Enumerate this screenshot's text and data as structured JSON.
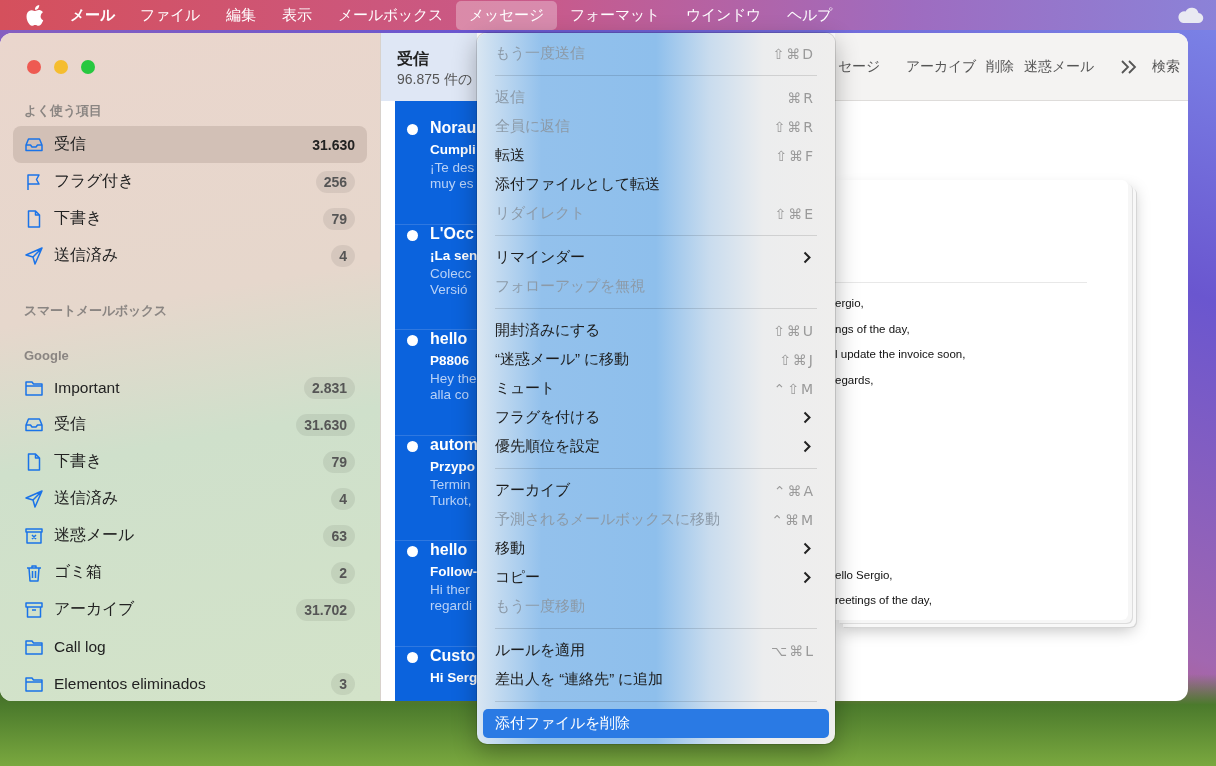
{
  "menu_bar": {
    "app_name": "メール",
    "items": [
      {
        "label": "ファイル",
        "selected": false
      },
      {
        "label": "編集",
        "selected": false
      },
      {
        "label": "表示",
        "selected": false
      },
      {
        "label": "メールボックス",
        "selected": false
      },
      {
        "label": "メッセージ",
        "selected": true
      },
      {
        "label": "フォーマット",
        "selected": false
      },
      {
        "label": "ウインドウ",
        "selected": false
      },
      {
        "label": "ヘルプ",
        "selected": false
      }
    ]
  },
  "sidebar": {
    "sections": [
      {
        "title": "よく使う項目",
        "items": [
          {
            "kind": "inbox",
            "label": "受信",
            "count": "31.630",
            "selected": true
          },
          {
            "kind": "flag",
            "label": "フラグ付き",
            "count": "256",
            "selected": false
          },
          {
            "kind": "draft",
            "label": "下書き",
            "count": "79",
            "selected": false
          },
          {
            "kind": "sent",
            "label": "送信済み",
            "count": "4",
            "selected": false
          }
        ]
      },
      {
        "title": "スマートメールボックス"
      },
      {
        "title": "Google",
        "items": [
          {
            "kind": "folder",
            "label": "Important",
            "count": "2.831",
            "selected": false
          },
          {
            "kind": "inbox",
            "label": "受信",
            "count": "31.630",
            "selected": false
          },
          {
            "kind": "draft",
            "label": "下書き",
            "count": "79",
            "selected": false
          },
          {
            "kind": "sent",
            "label": "送信済み",
            "count": "4",
            "selected": false
          },
          {
            "kind": "junk",
            "label": "迷惑メール",
            "count": "63",
            "selected": false
          },
          {
            "kind": "trash",
            "label": "ゴミ箱",
            "count": "2",
            "selected": false
          },
          {
            "kind": "archive",
            "label": "アーカイブ",
            "count": "31.702",
            "selected": false
          },
          {
            "kind": "folder",
            "label": "Call log",
            "selected": false
          },
          {
            "kind": "folder",
            "label": "Elementos eliminados",
            "count": "3",
            "selected": false
          }
        ]
      }
    ]
  },
  "message_list": {
    "title": "受信",
    "subtitle": "96.875 件の",
    "messages": [
      {
        "sender": "Norau",
        "subject": "Cumpli",
        "preview": [
          "¡Te des",
          "muy es"
        ],
        "unread": true
      },
      {
        "sender": "L'Occ",
        "subject": "¡La sen",
        "preview": [
          "Colecc",
          "Versió"
        ],
        "unread": true
      },
      {
        "sender": "hello",
        "subject": "P8806",
        "preview": [
          "Hey the",
          "alla co"
        ],
        "unread": true
      },
      {
        "sender": "autom",
        "subject": "Przypo",
        "preview": [
          "Termin",
          "Turkot,"
        ],
        "unread": true
      },
      {
        "sender": "hello",
        "subject": "Follow-",
        "preview": [
          "Hi ther",
          "regardi"
        ],
        "unread": true
      },
      {
        "sender": "Custo",
        "subject": "Hi Serg",
        "unread": true
      }
    ]
  },
  "toolbar": {
    "items": [
      "セージ",
      "アーカイブ",
      "削除",
      "迷惑メール"
    ],
    "search": "検索"
  },
  "preview": {
    "top_lines": [
      "ergio,",
      "ngs of the day,",
      "l update the invoice soon,",
      "egards,"
    ],
    "bottom_lines": [
      "ello Sergio,",
      "reetings of the day,"
    ]
  },
  "context_menu": {
    "items": [
      {
        "kind": "item",
        "label": "もう一度送信",
        "shortcut": "⇧⌘D",
        "disabled": true,
        "submenu": false,
        "selected": false
      },
      {
        "kind": "separator"
      },
      {
        "kind": "item",
        "label": "返信",
        "shortcut": "⌘R",
        "disabled": true,
        "submenu": false,
        "selected": false
      },
      {
        "kind": "item",
        "label": "全員に返信",
        "shortcut": "⇧⌘R",
        "disabled": true,
        "submenu": false,
        "selected": false
      },
      {
        "kind": "item",
        "label": "転送",
        "shortcut": "⇧⌘F",
        "disabled": false,
        "submenu": false,
        "selected": false
      },
      {
        "kind": "item",
        "label": "添付ファイルとして転送",
        "disabled": false,
        "submenu": false,
        "selected": false
      },
      {
        "kind": "item",
        "label": "リダイレクト",
        "shortcut": "⇧⌘E",
        "disabled": true,
        "submenu": false,
        "selected": false
      },
      {
        "kind": "separator"
      },
      {
        "kind": "item",
        "label": "リマインダー",
        "disabled": false,
        "submenu": true,
        "selected": false
      },
      {
        "kind": "item",
        "label": "フォローアップを無視",
        "disabled": true,
        "submenu": false,
        "selected": false
      },
      {
        "kind": "separator"
      },
      {
        "kind": "item",
        "label": "開封済みにする",
        "shortcut": "⇧⌘U",
        "disabled": false,
        "submenu": false,
        "selected": false
      },
      {
        "kind": "item",
        "label": "“迷惑メール” に移動",
        "shortcut": "⇧⌘J",
        "disabled": false,
        "submenu": false,
        "selected": false
      },
      {
        "kind": "item",
        "label": "ミュート",
        "shortcut": "⌃⇧M",
        "disabled": false,
        "submenu": false,
        "selected": false
      },
      {
        "kind": "item",
        "label": "フラグを付ける",
        "disabled": false,
        "submenu": true,
        "selected": false
      },
      {
        "kind": "item",
        "label": "優先順位を設定",
        "disabled": false,
        "submenu": true,
        "selected": false
      },
      {
        "kind": "separator"
      },
      {
        "kind": "item",
        "label": "アーカイブ",
        "shortcut": "⌃⌘A",
        "disabled": false,
        "submenu": false,
        "selected": false
      },
      {
        "kind": "item",
        "label": "予測されるメールボックスに移動",
        "shortcut": "⌃⌘M",
        "disabled": true,
        "submenu": false,
        "selected": false
      },
      {
        "kind": "item",
        "label": "移動",
        "disabled": false,
        "submenu": true,
        "selected": false
      },
      {
        "kind": "item",
        "label": "コピー",
        "disabled": false,
        "submenu": true,
        "selected": false
      },
      {
        "kind": "item",
        "label": "もう一度移動",
        "disabled": true,
        "submenu": false,
        "selected": false
      },
      {
        "kind": "separator"
      },
      {
        "kind": "item",
        "label": "ルールを適用",
        "shortcut": "⌥⌘L",
        "disabled": false,
        "submenu": false,
        "selected": false
      },
      {
        "kind": "item",
        "label": "差出人を “連絡先” に追加",
        "disabled": false,
        "submenu": false,
        "selected": false
      },
      {
        "kind": "separator"
      },
      {
        "kind": "item",
        "label": "添付ファイルを削除",
        "disabled": false,
        "submenu": false,
        "selected": true
      }
    ]
  }
}
